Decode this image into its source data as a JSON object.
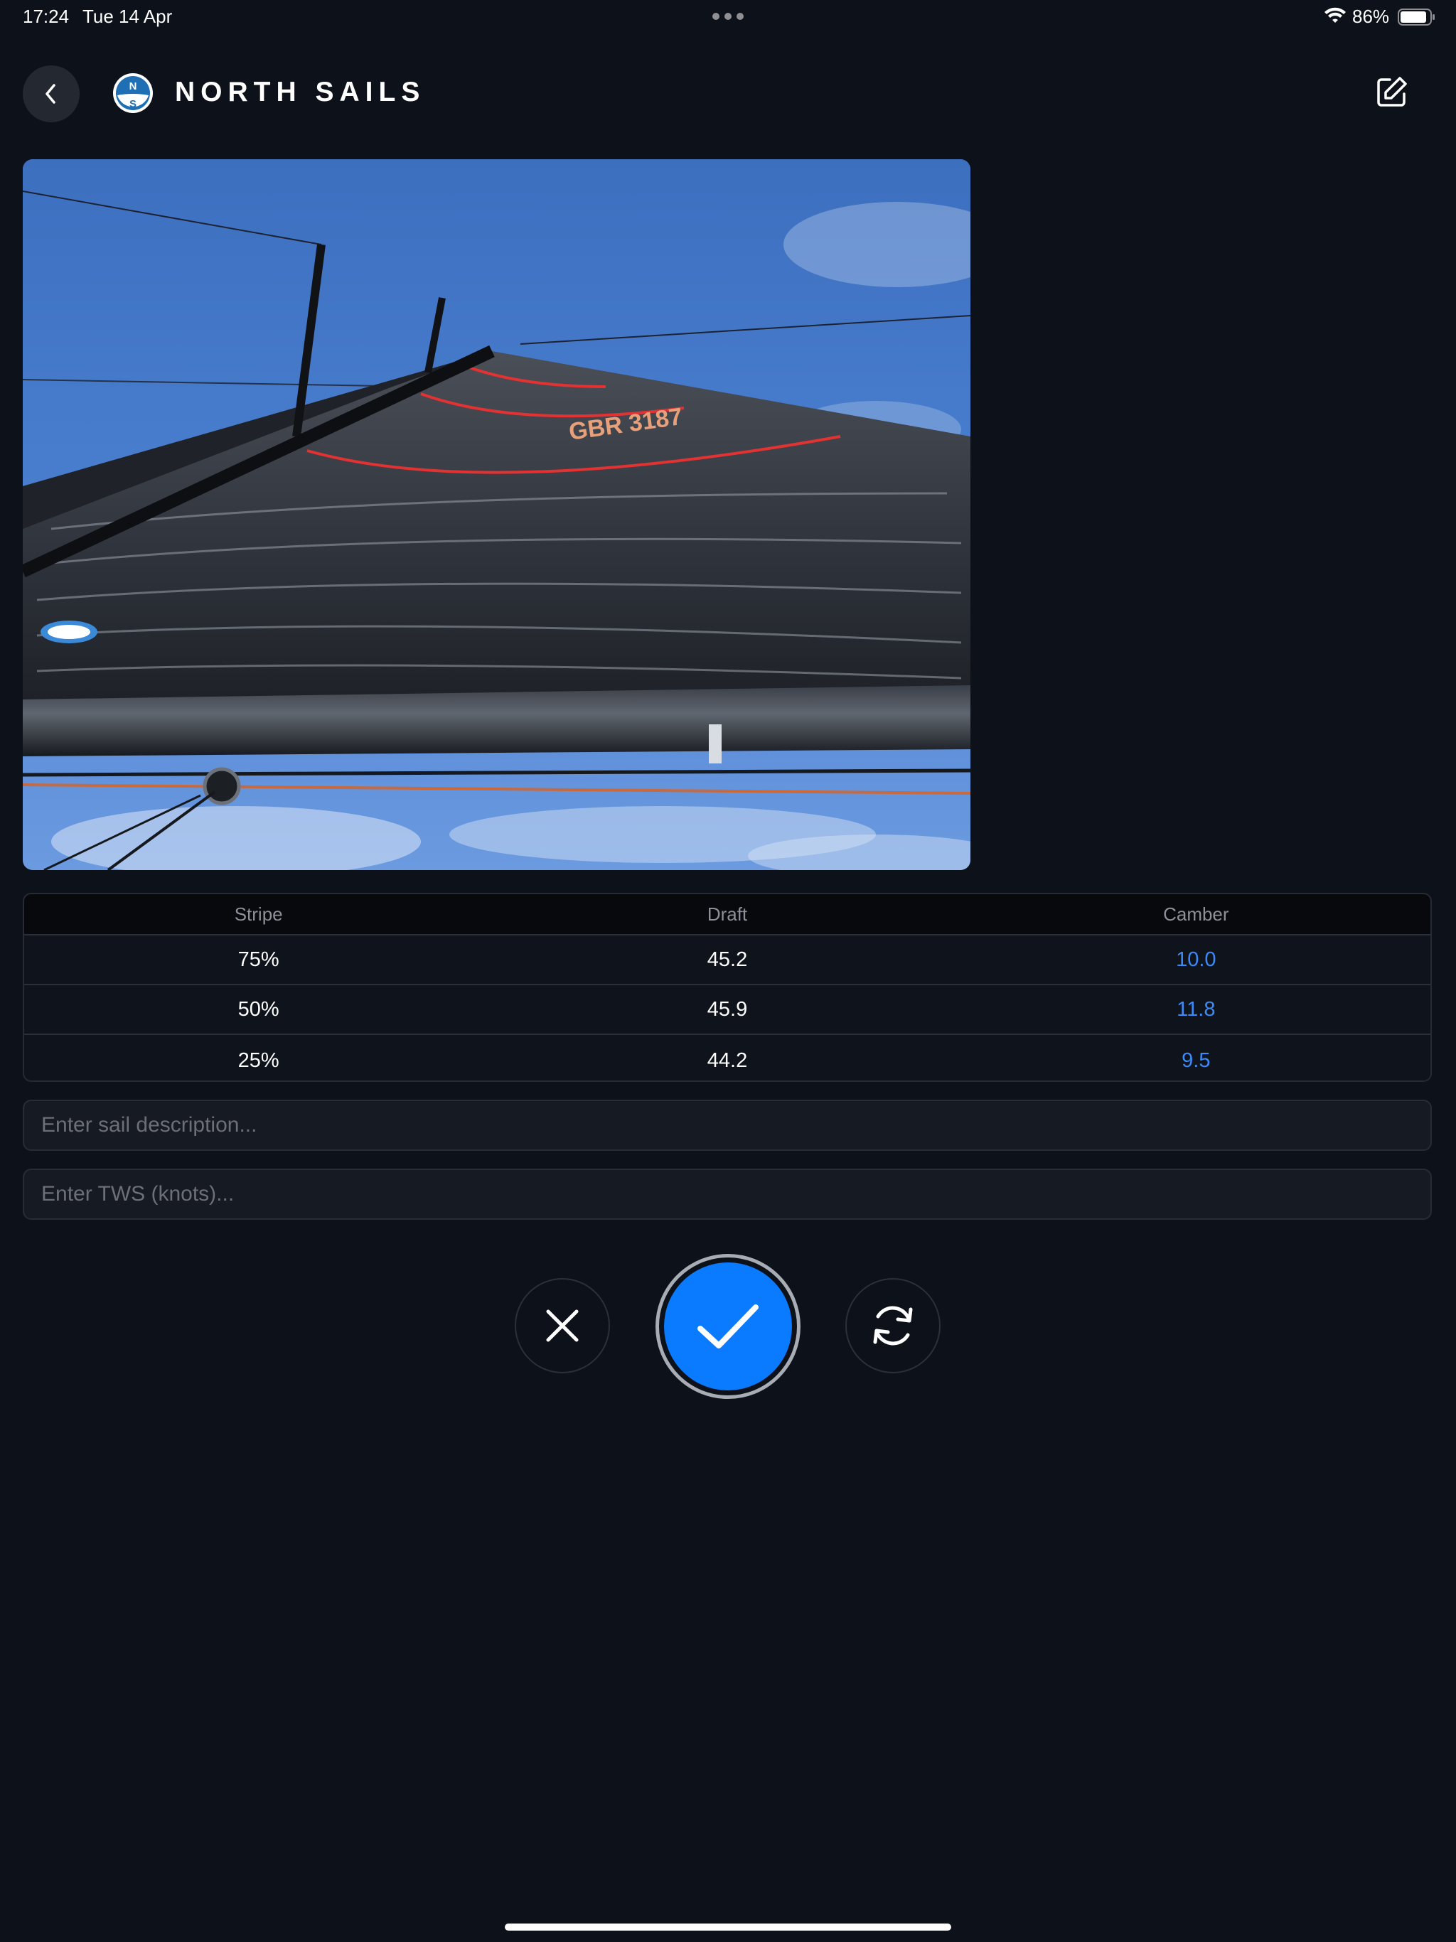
{
  "status_bar": {
    "time": "17:24",
    "date": "Tue 14 Apr",
    "battery": "86%"
  },
  "header": {
    "logo_letters": [
      "N",
      "S"
    ],
    "brand_name": "NORTH SAILS"
  },
  "photo": {
    "sail_number": "GBR 3187",
    "description": "Mainsail viewed from the boom looking up at the mast with red draft stripes"
  },
  "table": {
    "columns": [
      "Stripe",
      "Draft",
      "Camber"
    ],
    "rows": [
      {
        "stripe": "75%",
        "draft": "45.2",
        "camber": "10.0"
      },
      {
        "stripe": "50%",
        "draft": "45.9",
        "camber": "11.8"
      },
      {
        "stripe": "25%",
        "draft": "44.2",
        "camber": "9.5"
      }
    ]
  },
  "inputs": {
    "description_placeholder": "Enter sail description...",
    "description_value": "",
    "tws_placeholder": "Enter TWS (knots)...",
    "tws_value": ""
  },
  "actions": {
    "cancel_icon": "close-icon",
    "confirm_icon": "checkmark-icon",
    "retry_icon": "refresh-icon"
  },
  "colors": {
    "background": "#0d111a",
    "accent": "#0a7aff",
    "camber_text": "#3b8af6"
  }
}
